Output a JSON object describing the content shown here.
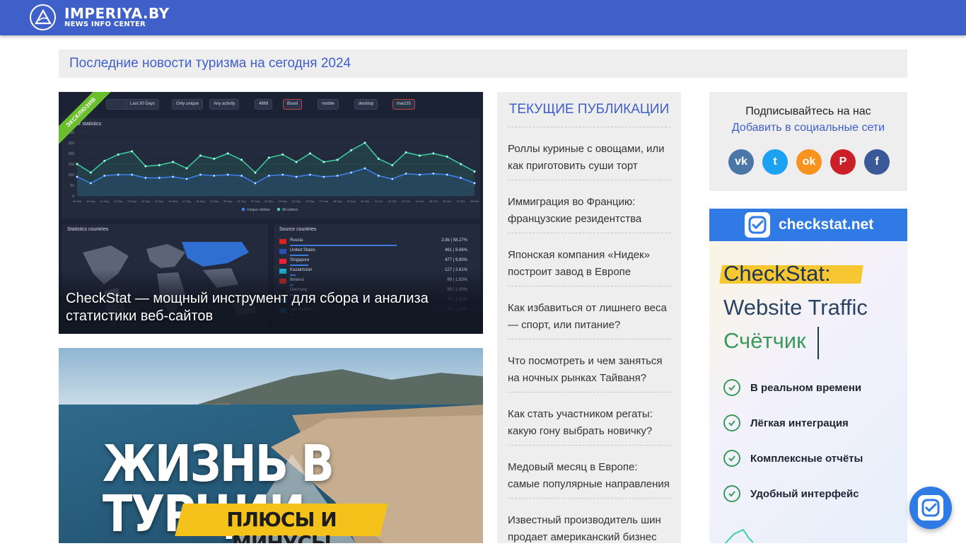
{
  "header": {
    "logo_title": "IMPERIYA.BY",
    "logo_subtitle": "NEWS INFO CENTER",
    "background_color": "#3f5fc9"
  },
  "headline": "Последние новости туризма на сегодня 2024",
  "featured": [
    {
      "badge": "ЭКСКЛЮЗИВ",
      "title": "CheckStat — мощный инструмент для сбора и анализа статистики веб-сайтов",
      "image": {
        "filters": [
          "Last 30 Days",
          "Only unique",
          "Any activity",
          "4869",
          "Brasil",
          "mobile",
          "desktop",
          "macOS"
        ],
        "chart_title": "Visitor statistics",
        "legend": [
          "Unique visitors",
          "All visitors"
        ],
        "chart_data": {
          "type": "area",
          "x": [
            "09 Sep",
            "10 Sep",
            "11 Sep",
            "12 Sep",
            "13 Sep",
            "14 Sep",
            "15 Sep",
            "16 Sep",
            "17 Sep",
            "18 Sep",
            "19 Sep",
            "20 Sep",
            "21 Sep",
            "22 Sep",
            "23 Sep",
            "24 Sep",
            "25 Sep",
            "26 Sep",
            "27 Sep",
            "28 Sep",
            "29 Sep",
            "30 Sep",
            "01 Oct",
            "02 Oct",
            "03 Oct",
            "04 Oct",
            "05 Oct",
            "06 Oct",
            "07 Oct",
            "08 Oct"
          ],
          "ylim": [
            0,
            300
          ],
          "yticks": [
            "300",
            "250",
            "200",
            "150",
            "100",
            "50",
            "0"
          ],
          "series": [
            {
              "name": "All visitors",
              "color": "#3ad29f",
              "values": [
                150,
                110,
                165,
                195,
                210,
                140,
                145,
                160,
                130,
                190,
                175,
                200,
                170,
                110,
                180,
                195,
                160,
                200,
                160,
                170,
                215,
                250,
                175,
                145,
                205,
                190,
                200,
                185,
                150,
                115
              ]
            },
            {
              "name": "Unique visitors",
              "color": "#3b82f6",
              "values": [
                90,
                60,
                95,
                100,
                100,
                85,
                85,
                90,
                80,
                100,
                95,
                100,
                95,
                60,
                95,
                100,
                90,
                100,
                90,
                95,
                110,
                130,
                95,
                80,
                105,
                100,
                105,
                100,
                85,
                60
              ]
            }
          ]
        },
        "map_title": "Statistics countries",
        "countries_title": "Source countries",
        "countries": [
          {
            "name": "Russia",
            "value": "2.8k | 58.27%",
            "share": 0.58,
            "flag": "#d22"
          },
          {
            "name": "United States",
            "value": "461 | 9.66%",
            "share": 0.1,
            "flag": "#2a4fb5"
          },
          {
            "name": "Singapore",
            "value": "477 | 9.80%",
            "share": 0.1,
            "flag": "#e23"
          },
          {
            "name": "Kazakhstan",
            "value": "127 | 2.61%",
            "share": 0.03,
            "flag": "#1cb0d3"
          },
          {
            "name": "Belarus",
            "value": "89 | 1.83%",
            "share": 0.02,
            "flag": "#c8312d"
          },
          {
            "name": "Germany",
            "value": "89 | 1.83%",
            "share": 0.02,
            "flag": "#222"
          },
          {
            "name": "",
            "value": "76 | 1.61%",
            "share": 0.02,
            "flag": "#2f6fd1"
          },
          {
            "name": "Uzbekistan",
            "value": "73 | 1.50%",
            "share": 0.02,
            "flag": "#1e9be0"
          }
        ]
      }
    },
    {
      "title": "ЖИЗНЬ В ТУРЦИИ",
      "subtitle": "ПЛЮСЫ И МИНУСЫ"
    }
  ],
  "publications": {
    "title": "ТЕКУЩИЕ ПУБЛИКАЦИИ",
    "items": [
      "Роллы куриные с овощами, или как приготовить суши торт",
      "Иммиграция во Францию: французские резидентства",
      "Японская компания «Нидек» построит завод в Европе",
      "Как избавиться от лишнего веса — спорт, или питание?",
      "Что посмотреть и чем заняться на ночных рынках Тайваня?",
      "Как стать участником регаты: какую гону выбрать новичку?",
      "Медовый месяц в Европе: самые популярные направления",
      "Известный производитель шин продает американский бизнес"
    ]
  },
  "follow": {
    "title": "Подписывайтесь на нас",
    "link": "Добавить в социальные сети",
    "networks": [
      {
        "name": "vk-icon",
        "glyph": "vk",
        "color": "#4a76a8"
      },
      {
        "name": "twitter-icon",
        "glyph": "t",
        "color": "#1da1f2"
      },
      {
        "name": "odnoklassniki-icon",
        "glyph": "ok",
        "color": "#f7931e"
      },
      {
        "name": "pinterest-icon",
        "glyph": "P",
        "color": "#cb2027"
      },
      {
        "name": "facebook-icon",
        "glyph": "f",
        "color": "#3b5998"
      }
    ]
  },
  "ad": {
    "brand": "checkstat.net",
    "line1": "CheckStat:",
    "line2": "Website Traffic",
    "line3": "Счётчик",
    "features": [
      "В реальном времени",
      "Лёгкая интеграция",
      "Комплексные отчёты",
      "Удобный интерфейс"
    ]
  }
}
